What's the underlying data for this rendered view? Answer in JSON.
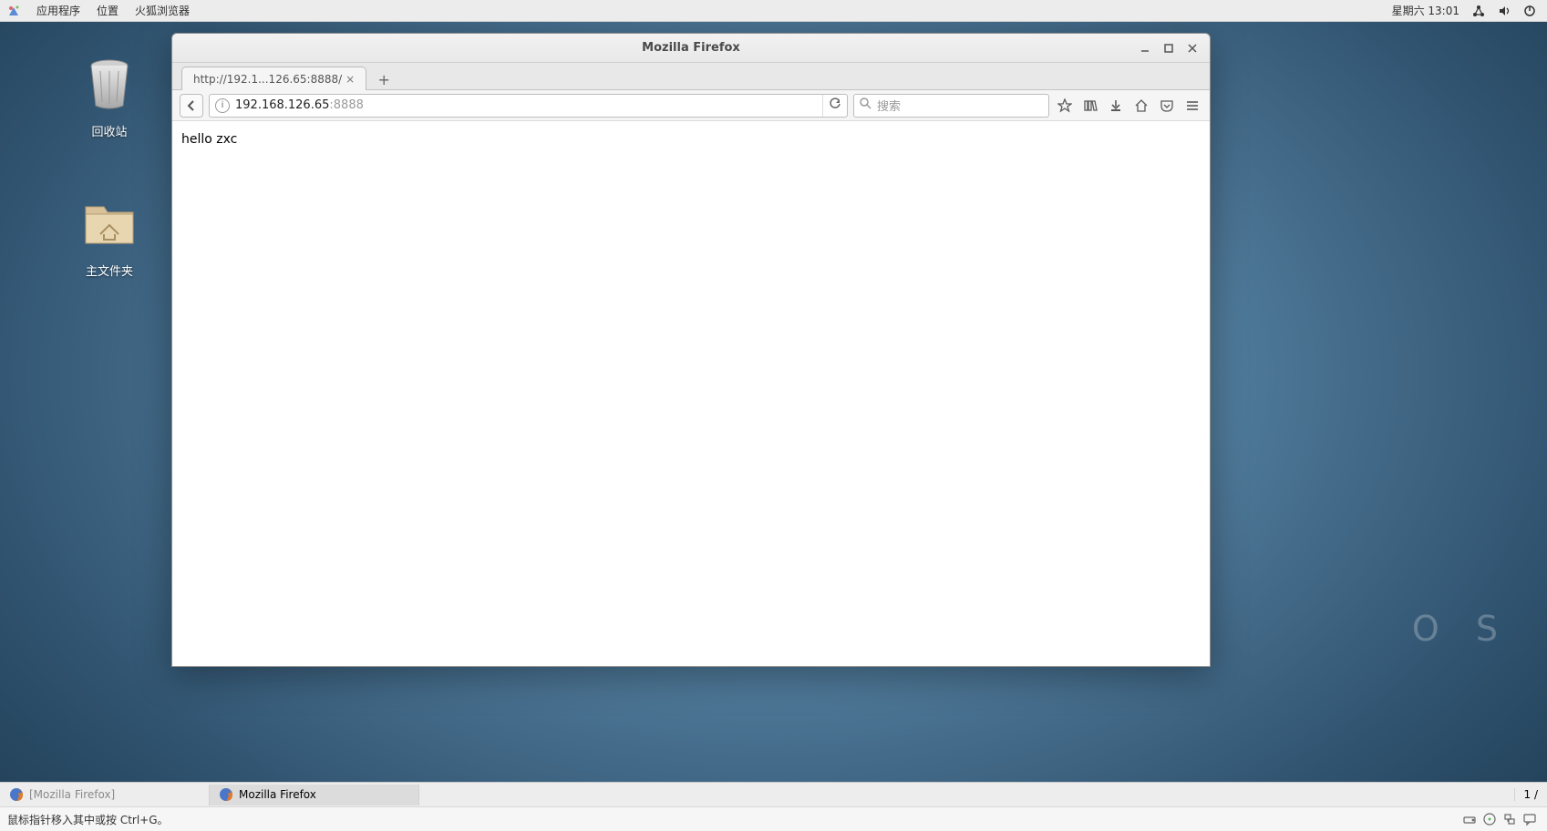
{
  "topbar": {
    "apps": "应用程序",
    "places": "位置",
    "firefox": "火狐浏览器",
    "datetime": "星期六 13:01"
  },
  "desktop": {
    "trash": "回收站",
    "home": "主文件夹",
    "watermark": "O S"
  },
  "window": {
    "title": "Mozilla Firefox",
    "tab_label": "http://192.1...126.65:8888/",
    "url_host": "192.168.126.65",
    "url_port": ":8888",
    "search_placeholder": "搜索",
    "page_text": "hello  zxc"
  },
  "taskbar": {
    "task1": "[Mozilla Firefox]",
    "task2": "Mozilla Firefox",
    "workspace": "1 / "
  },
  "status": {
    "hint": "鼠标指针移入其中或按 Ctrl+G。"
  }
}
